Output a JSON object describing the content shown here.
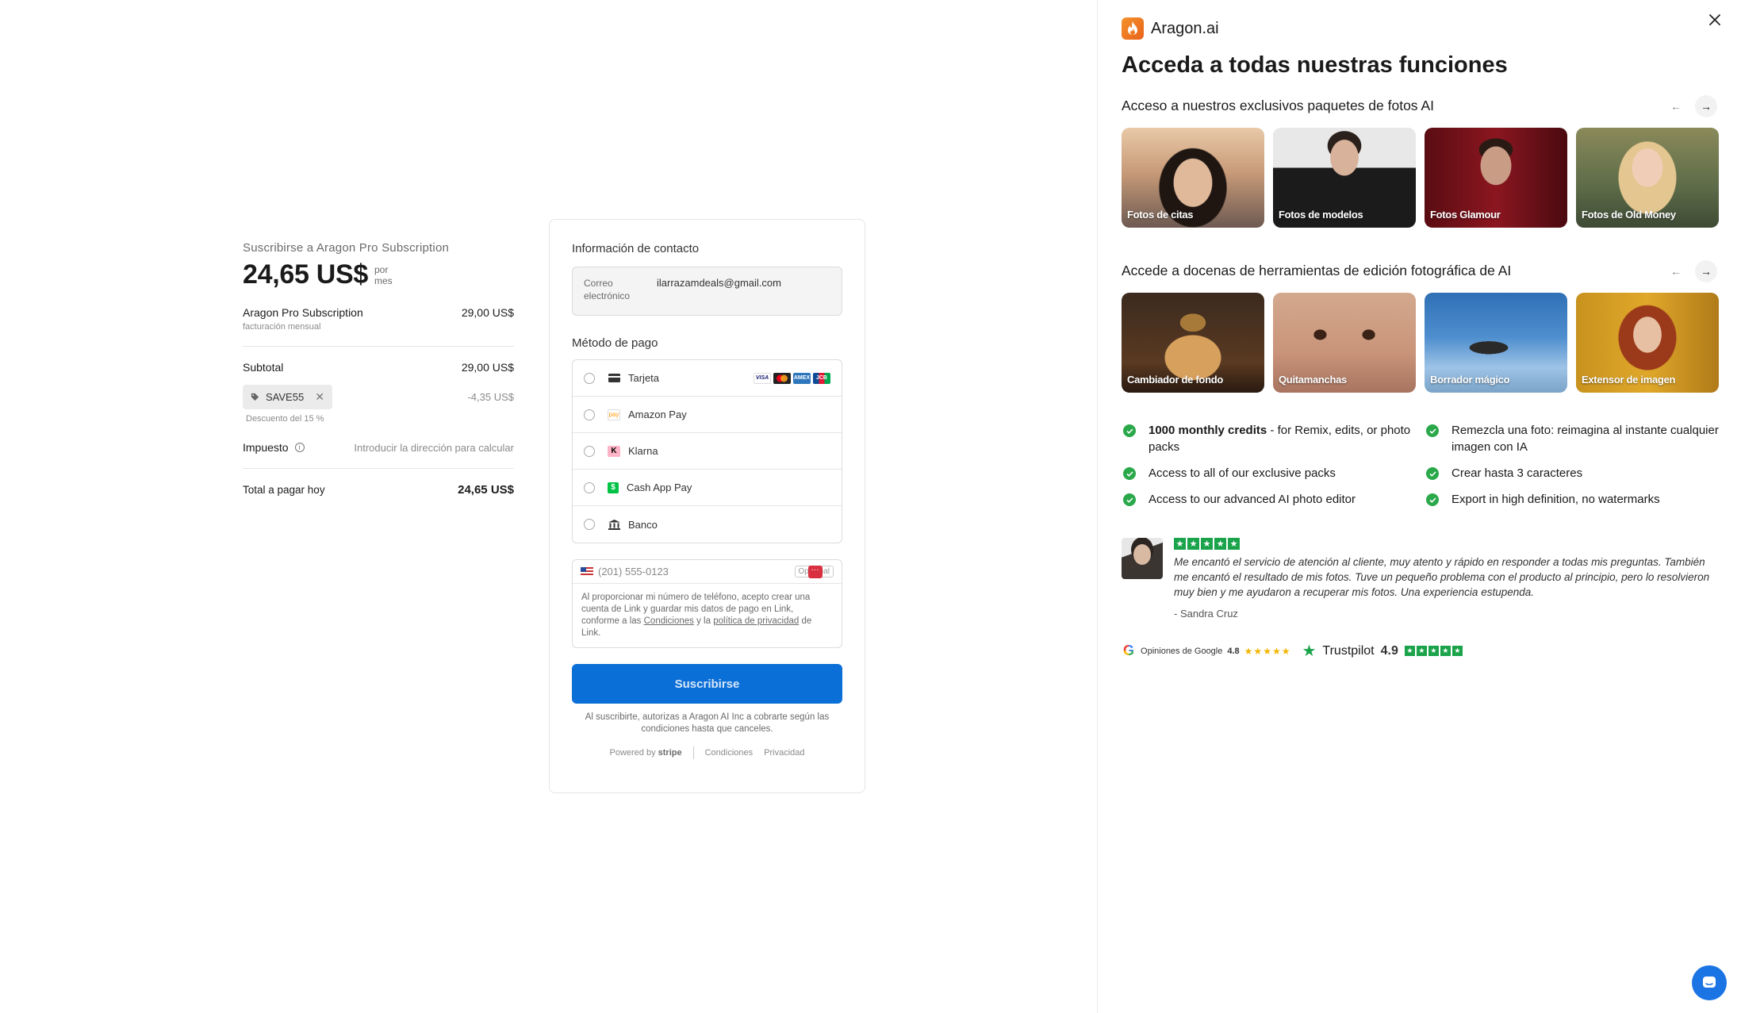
{
  "summary": {
    "title": "Suscribirse a Aragon Pro Subscription",
    "price": "24,65 US$",
    "per_line1": "por",
    "per_line2": "mes",
    "item_name": "Aragon Pro Subscription",
    "item_price": "29,00 US$",
    "item_billing": "facturación mensual",
    "subtotal_label": "Subtotal",
    "subtotal_value": "29,00 US$",
    "coupon_code": "SAVE55",
    "coupon_discount": "-4,35 US$",
    "coupon_desc": "Descuento del 15 %",
    "tax_label": "Impuesto",
    "tax_value": "Introducir la dirección para calcular",
    "total_label": "Total a pagar hoy",
    "total_value": "24,65 US$"
  },
  "checkout": {
    "contact_title": "Información de contacto",
    "email_label": "Correo electrónico",
    "email_value": "ilarrazamdeals@gmail.com",
    "payment_title": "Método de pago",
    "methods": [
      {
        "label": "Tarjeta"
      },
      {
        "label": "Amazon Pay"
      },
      {
        "label": "Klarna"
      },
      {
        "label": "Cash App Pay"
      },
      {
        "label": "Banco"
      }
    ],
    "card_brands": [
      "VISA",
      "MC",
      "AMEX",
      "JCB"
    ],
    "phone_placeholder": "(201) 555-0123",
    "optional_label": "Opcional",
    "phone_note_1": "Al proporcionar mi número de teléfono, acepto crear una cuenta de Link y guardar mis datos de pago en Link, conforme a las ",
    "terms_link": "Condiciones",
    "phone_note_2": " y la ",
    "privacy_link": "política de privacidad",
    "phone_note_3": " de Link.",
    "submit_label": "Suscribirse",
    "authorization": "Al suscribirte, autorizas a Aragon AI Inc a cobrarte según las condiciones hasta que canceles.",
    "powered_by": "Powered by",
    "stripe": "stripe",
    "footer_terms": "Condiciones",
    "footer_privacy": "Privacidad"
  },
  "panel": {
    "brand": "Aragon.ai",
    "headline": "Acceda a todas nuestras funciones",
    "section1_title": "Acceso a nuestros exclusivos paquetes de fotos AI",
    "packs": [
      {
        "label": "Fotos de citas"
      },
      {
        "label": "Fotos de modelos"
      },
      {
        "label": "Fotos Glamour"
      },
      {
        "label": "Fotos de Old Money"
      }
    ],
    "section2_title": "Accede a docenas de herramientas de edición fotográfica de AI",
    "tools": [
      {
        "label": "Cambiador de fondo"
      },
      {
        "label": "Quitamanchas"
      },
      {
        "label": "Borrador mágico"
      },
      {
        "label": "Extensor de imagen"
      }
    ],
    "features": [
      {
        "bold": "1000 monthly credits",
        "text": " - for Remix, edits, or photo packs"
      },
      {
        "bold": "",
        "text": "Remezcla una foto: reimagina al instante cualquier imagen con IA"
      },
      {
        "bold": "",
        "text": "Access to all of our exclusive packs"
      },
      {
        "bold": "",
        "text": "Crear hasta 3 caracteres"
      },
      {
        "bold": "",
        "text": "Access to our advanced AI photo editor"
      },
      {
        "bold": "",
        "text": "Export in high definition, no watermarks"
      }
    ],
    "review_text": "Me encantó el servicio de atención al cliente, muy atento y rápido en responder a todas mis preguntas. También me encantó el resultado de mis fotos. Tuve un pequeño problema con el producto al principio, pero lo resolvieron muy bien y me ayudaron a recuperar mis fotos. Una experiencia estupenda.",
    "review_author": "- Sandra Cruz",
    "review_stars": 5,
    "google_label": "Opiniones de Google",
    "google_score": "4.8",
    "trustpilot_label": "Trustpilot",
    "trustpilot_score": "4.9"
  },
  "colors": {
    "primary_button": "#0a6fd6",
    "check_green": "#2aa84a",
    "trustpilot_green": "#1aa34a",
    "brand_orange": "#f07a22",
    "chat_blue": "#1b74e4"
  }
}
